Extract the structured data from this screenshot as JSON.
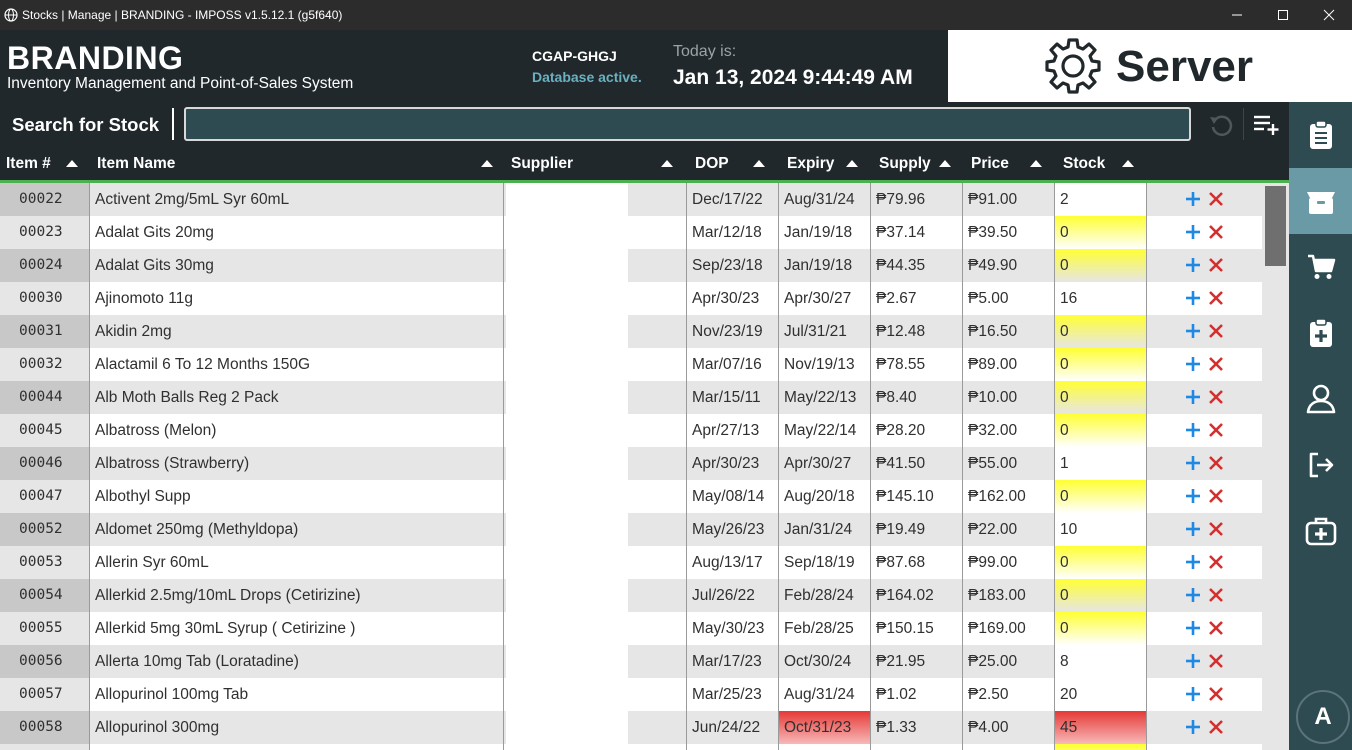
{
  "window": {
    "title": "Stocks | Manage | BRANDING - IMPOSS v1.5.12.1 (g5f640)",
    "icon": "globe-icon",
    "controls": [
      "minimize-icon",
      "maximize-icon",
      "close-icon"
    ]
  },
  "header": {
    "brand": "BRANDING",
    "subtitle": "Inventory Management and Point-of-Sales System",
    "db_code": "CGAP-GHGJ",
    "db_status": "Database active.",
    "today_label": "Today is:",
    "today_value": "Jan 13, 2024 9:44:49 AM",
    "server_label": "Server",
    "server_icon": "gear-icon"
  },
  "search": {
    "label": "Search for Stock",
    "value": "",
    "placeholder": "",
    "refresh_icon": "refresh-icon",
    "add_icon": "playlist-add-icon"
  },
  "table": {
    "columns": [
      {
        "key": "item_no",
        "label": "Item #"
      },
      {
        "key": "item_name",
        "label": "Item Name"
      },
      {
        "key": "supplier",
        "label": "Supplier"
      },
      {
        "key": "dop",
        "label": "DOP"
      },
      {
        "key": "expiry",
        "label": "Expiry"
      },
      {
        "key": "supply",
        "label": "Supply"
      },
      {
        "key": "price",
        "label": "Price"
      },
      {
        "key": "stock",
        "label": "Stock"
      }
    ],
    "rows": [
      {
        "item_no": "00022",
        "item_name": "Activent 2mg/5mL Syr 60mL",
        "supplier": "",
        "dop": "Dec/17/22",
        "expiry": "Aug/31/24",
        "supply": "₱79.96",
        "price": "₱91.00",
        "stock": "2",
        "stock_status": "ok",
        "expired": false
      },
      {
        "item_no": "00023",
        "item_name": "Adalat Gits 20mg",
        "supplier": "",
        "dop": "Mar/12/18",
        "expiry": "Jan/19/18",
        "supply": "₱37.14",
        "price": "₱39.50",
        "stock": "0",
        "stock_status": "empty",
        "expired": false
      },
      {
        "item_no": "00024",
        "item_name": "Adalat Gits 30mg",
        "supplier": "",
        "dop": "Sep/23/18",
        "expiry": "Jan/19/18",
        "supply": "₱44.35",
        "price": "₱49.90",
        "stock": "0",
        "stock_status": "empty",
        "expired": false
      },
      {
        "item_no": "00030",
        "item_name": "Ajinomoto 11g",
        "supplier": "",
        "dop": "Apr/30/23",
        "expiry": "Apr/30/27",
        "supply": "₱2.67",
        "price": "₱5.00",
        "stock": "16",
        "stock_status": "ok",
        "expired": false
      },
      {
        "item_no": "00031",
        "item_name": "Akidin 2mg",
        "supplier": "",
        "dop": "Nov/23/19",
        "expiry": "Jul/31/21",
        "supply": "₱12.48",
        "price": "₱16.50",
        "stock": "0",
        "stock_status": "empty",
        "expired": false
      },
      {
        "item_no": "00032",
        "item_name": "Alactamil 6 To 12 Months 150G",
        "supplier": "",
        "dop": "Mar/07/16",
        "expiry": "Nov/19/13",
        "supply": "₱78.55",
        "price": "₱89.00",
        "stock": "0",
        "stock_status": "empty",
        "expired": false
      },
      {
        "item_no": "00044",
        "item_name": "Alb Moth Balls Reg 2 Pack",
        "supplier": "",
        "dop": "Mar/15/11",
        "expiry": "May/22/13",
        "supply": "₱8.40",
        "price": "₱10.00",
        "stock": "0",
        "stock_status": "empty",
        "expired": false
      },
      {
        "item_no": "00045",
        "item_name": "Albatross (Melon)",
        "supplier": "",
        "dop": "Apr/27/13",
        "expiry": "May/22/14",
        "supply": "₱28.20",
        "price": "₱32.00",
        "stock": "0",
        "stock_status": "empty",
        "expired": false
      },
      {
        "item_no": "00046",
        "item_name": "Albatross (Strawberry)",
        "supplier": "",
        "dop": "Apr/30/23",
        "expiry": "Apr/30/27",
        "supply": "₱41.50",
        "price": "₱55.00",
        "stock": "1",
        "stock_status": "ok",
        "expired": false
      },
      {
        "item_no": "00047",
        "item_name": "Albothyl Supp",
        "supplier": "",
        "dop": "May/08/14",
        "expiry": "Aug/20/18",
        "supply": "₱145.10",
        "price": "₱162.00",
        "stock": "0",
        "stock_status": "empty",
        "expired": false
      },
      {
        "item_no": "00052",
        "item_name": "Aldomet 250mg (Methyldopa)",
        "supplier": "",
        "dop": "May/26/23",
        "expiry": "Jan/31/24",
        "supply": "₱19.49",
        "price": "₱22.00",
        "stock": "10",
        "stock_status": "ok",
        "expired": false
      },
      {
        "item_no": "00053",
        "item_name": "Allerin Syr 60mL",
        "supplier": "",
        "dop": "Aug/13/17",
        "expiry": "Sep/18/19",
        "supply": "₱87.68",
        "price": "₱99.00",
        "stock": "0",
        "stock_status": "empty",
        "expired": false
      },
      {
        "item_no": "00054",
        "item_name": "Allerkid 2.5mg/10mL Drops (Cetirizine)",
        "supplier": "",
        "dop": "Jul/26/22",
        "expiry": "Feb/28/24",
        "supply": "₱164.02",
        "price": "₱183.00",
        "stock": "0",
        "stock_status": "empty",
        "expired": false
      },
      {
        "item_no": "00055",
        "item_name": "Allerkid 5mg 30mL Syrup ( Cetirizine )",
        "supplier": "",
        "dop": "May/30/23",
        "expiry": "Feb/28/25",
        "supply": "₱150.15",
        "price": "₱169.00",
        "stock": "0",
        "stock_status": "empty",
        "expired": false
      },
      {
        "item_no": "00056",
        "item_name": "Allerta 10mg Tab (Loratadine)",
        "supplier": "",
        "dop": "Mar/17/23",
        "expiry": "Oct/30/24",
        "supply": "₱21.95",
        "price": "₱25.00",
        "stock": "8",
        "stock_status": "ok",
        "expired": false
      },
      {
        "item_no": "00057",
        "item_name": "Allopurinol 100mg Tab",
        "supplier": "",
        "dop": "Mar/25/23",
        "expiry": "Aug/31/24",
        "supply": "₱1.02",
        "price": "₱2.50",
        "stock": "20",
        "stock_status": "ok",
        "expired": false
      },
      {
        "item_no": "00058",
        "item_name": "Allopurinol 300mg",
        "supplier": "",
        "dop": "Jun/24/22",
        "expiry": "Oct/31/23",
        "supply": "₱1.33",
        "price": "₱4.00",
        "stock": "45",
        "stock_status": "alert",
        "expired": true
      },
      {
        "item_no": "",
        "item_name": "",
        "supplier": "",
        "dop": "",
        "expiry": "",
        "supply": "",
        "price": "",
        "stock": "",
        "stock_status": "empty",
        "expired": false
      }
    ],
    "row_actions": [
      "plus-icon",
      "delete-x-icon"
    ]
  },
  "sidebar": {
    "items": [
      {
        "name": "clipboard-icon",
        "active": false
      },
      {
        "name": "box-icon",
        "active": true
      },
      {
        "name": "cart-icon",
        "active": false
      },
      {
        "name": "medical-clipboard-icon",
        "active": false
      },
      {
        "name": "user-icon",
        "active": false
      },
      {
        "name": "logout-icon",
        "active": false
      },
      {
        "name": "first-aid-kit-icon",
        "active": false
      }
    ],
    "avatar": "A"
  },
  "colors": {
    "header_bg": "#21282b",
    "sidebar_bg": "#2e4b51",
    "sidebar_active": "#6a9aa5",
    "db_status": "#6ab0c0",
    "accent_green": "#4caf50",
    "action_plus": "#1e88e5",
    "action_delete": "#d32f2f",
    "stock_empty": "#ffff33",
    "stock_alert": "#e53935"
  }
}
